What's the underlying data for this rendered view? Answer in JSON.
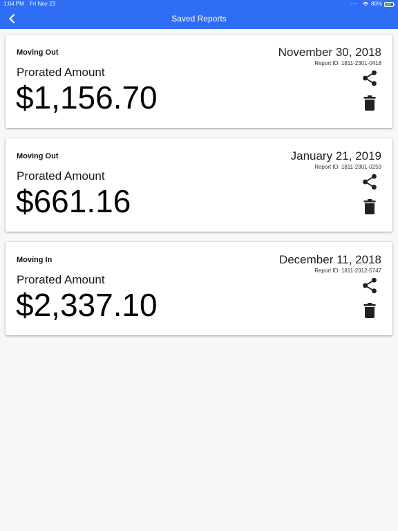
{
  "status_bar": {
    "time": "1:04 PM",
    "date": "Fri Nov 23",
    "battery": "86%"
  },
  "nav": {
    "title": "Saved Reports",
    "back_icon": "chevron-left-icon"
  },
  "reports": [
    {
      "type": "Moving Out",
      "date": "November 30, 2018",
      "report_id": "Report ID: 1811-2301-0418",
      "label": "Prorated Amount",
      "amount": "$1,156.70"
    },
    {
      "type": "Moving Out",
      "date": "January 21, 2019",
      "report_id": "Report ID: 1811-2301-0259",
      "label": "Prorated Amount",
      "amount": "$661.16"
    },
    {
      "type": "Moving In",
      "date": "December 11, 2018",
      "report_id": "Report ID: 1811-2312-5747",
      "label": "Prorated Amount",
      "amount": "$2,337.10"
    }
  ],
  "colors": {
    "accent": "#2f6df4",
    "background": "#f7f7f7",
    "card": "#ffffff"
  }
}
